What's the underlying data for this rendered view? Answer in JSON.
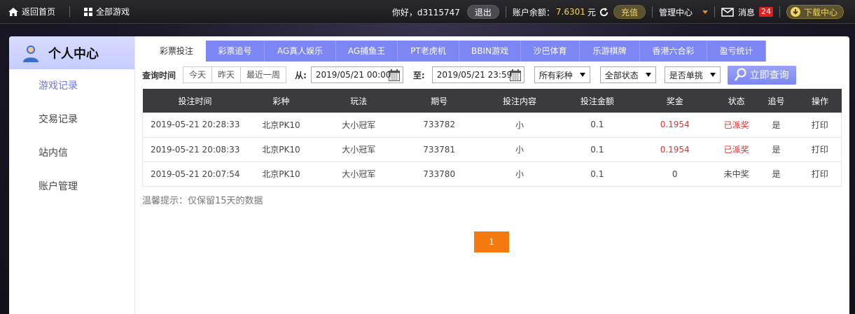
{
  "topbar": {
    "home_label": "返回首页",
    "games_label": "全部游戏",
    "greeting": "你好，d3115747",
    "logout_label": "退出",
    "balance_label": "账户余额：",
    "balance_value": "7.6301",
    "balance_unit": "元",
    "recharge_label": "充值",
    "manage_label": "管理中心",
    "message_label": "消息",
    "message_count": "24",
    "download_label": "下载中心"
  },
  "sidebar": {
    "title": "个人中心",
    "items": [
      {
        "label": "游戏记录"
      },
      {
        "label": "交易记录"
      },
      {
        "label": "站内信"
      },
      {
        "label": "账户管理"
      }
    ]
  },
  "tabs": [
    {
      "label": "彩票投注"
    },
    {
      "label": "彩票追号"
    },
    {
      "label": "AG真人娱乐"
    },
    {
      "label": "AG捕鱼王"
    },
    {
      "label": "PT老虎机"
    },
    {
      "label": "BBIN游戏"
    },
    {
      "label": "沙巴体育"
    },
    {
      "label": "乐游棋牌"
    },
    {
      "label": "香港六合彩"
    },
    {
      "label": "盈亏统计"
    }
  ],
  "filters": {
    "query_time_label": "查询时间",
    "today": "今天",
    "yesterday": "昨天",
    "last_week": "最近一周",
    "from_label": "从:",
    "from_value": "2019/05/21 00:00",
    "to_label": "至:",
    "to_value": "2019/05/21 23:59",
    "lottery_select": "所有彩种",
    "status_select": "全部状态",
    "single_select": "是否单挑",
    "query_button": "立即查询"
  },
  "table": {
    "headers": [
      "投注时间",
      "彩种",
      "玩法",
      "期号",
      "投注内容",
      "投注金额",
      "奖金",
      "状态",
      "追号",
      "操作"
    ],
    "rows": [
      {
        "time": "2019-05-21 20:28:33",
        "lottery": "北京PK10",
        "play": "大小冠军",
        "issue": "733782",
        "content": "小",
        "amount": "0.1",
        "bonus": "0.1954",
        "status": "已派奖",
        "chase": "是",
        "action": "打印"
      },
      {
        "time": "2019-05-21 20:08:33",
        "lottery": "北京PK10",
        "play": "大小冠军",
        "issue": "733781",
        "content": "小",
        "amount": "0.1",
        "bonus": "0.1954",
        "status": "已派奖",
        "chase": "是",
        "action": "打印"
      },
      {
        "time": "2019-05-21 20:07:54",
        "lottery": "北京PK10",
        "play": "大小冠军",
        "issue": "733780",
        "content": "小",
        "amount": "0.1",
        "bonus": "0",
        "status": "未中奖",
        "chase": "是",
        "action": "打印"
      }
    ]
  },
  "tip": "温馨提示：仅保留15天的数据",
  "pager": {
    "current": "1"
  },
  "colors": {
    "accent": "#7c87f5",
    "dark": "#3b3b3d",
    "win": "#e03030",
    "pager": "#f47a10",
    "gold": "#f3d45a"
  }
}
